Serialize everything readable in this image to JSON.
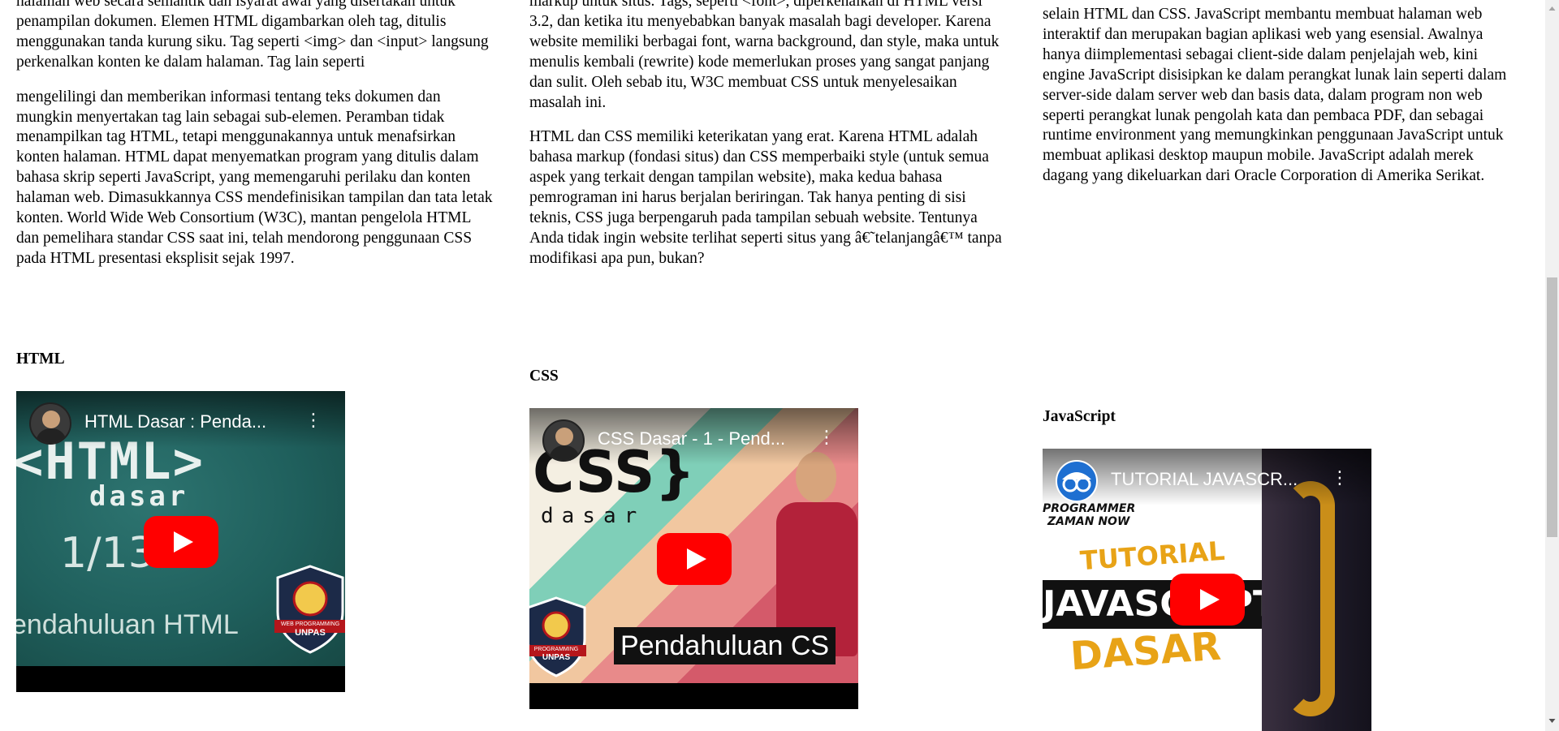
{
  "columns": [
    {
      "id": "html",
      "para1": "halaman web secara semantik dan isyarat awal yang disertakan untuk penampilan dokumen. Elemen HTML digambarkan oleh tag, ditulis menggunakan tanda kurung siku. Tag seperti <img> dan <input> langsung perkenalkan konten ke dalam halaman. Tag lain seperti",
      "para2": "mengelilingi dan memberikan informasi tentang teks dokumen dan mungkin menyertakan tag lain sebagai sub-elemen. Peramban tidak menampilkan tag HTML, tetapi menggunakannya untuk menafsirkan konten halaman. HTML dapat menyematkan program yang ditulis dalam bahasa skrip seperti JavaScript, yang memengaruhi perilaku dan konten halaman web. Dimasukkannya CSS mendefinisikan tampilan dan tata letak konten. World Wide Web Consortium (W3C), mantan pengelola HTML dan pemelihara standar CSS saat ini, telah mendorong penggunaan CSS pada HTML presentasi eksplisit sejak 1997.",
      "heading": "HTML",
      "video": {
        "title": "HTML Dasar : Penda...",
        "thumb_big": "<HTML>",
        "thumb_sub": "dasar",
        "thumb_num": "1/13",
        "thumb_caption": "endahuluan HTML",
        "badge_text": "WEB PROGRAMMING",
        "badge_name": "UNPAS"
      }
    },
    {
      "id": "css",
      "para1": "markup untuk situs. Tags, seperti <font>, diperkenalkan di HTML versi 3.2, dan ketika itu menyebabkan banyak masalah bagi developer. Karena website memiliki berbagai font, warna background, dan style, maka untuk menulis kembali (rewrite) kode memerlukan proses yang sangat panjang dan sulit. Oleh sebab itu, W3C membuat CSS untuk menyelesaikan masalah ini.",
      "para2": "HTML dan CSS memiliki keterikatan yang erat. Karena HTML adalah bahasa markup (fondasi situs) dan CSS memperbaiki style (untuk semua aspek yang terkait dengan tampilan website), maka kedua bahasa pemrograman ini harus berjalan beriringan. Tak hanya penting di sisi teknis, CSS juga berpengaruh pada tampilan sebuah website. Tentunya Anda tidak ingin website terlihat seperti situs yang â€˜telanjangâ€™ tanpa modifikasi apa pun, bukan?",
      "heading": "CSS",
      "video": {
        "title": "CSS Dasar - 1 - Pend...",
        "thumb_big": "CSS}",
        "thumb_sub": "dasar",
        "thumb_caption": "Pendahuluan CS",
        "badge_text": "PROGRAMMING",
        "badge_name": "UNPAS"
      }
    },
    {
      "id": "js",
      "para1": "selain HTML dan CSS. JavaScript membantu membuat halaman web interaktif dan merupakan bagian aplikasi web yang esensial. Awalnya hanya diimplementasi sebagai client-side dalam penjelajah web, kini engine JavaScript disisipkan ke dalam perangkat lunak lain seperti dalam server-side dalam server web dan basis data, dalam program non web seperti perangkat lunak pengolah kata dan pembaca PDF, dan sebagai runtime environment yang memungkinkan penggunaan JavaScript untuk membuat aplikasi desktop maupun mobile. JavaScript adalah merek dagang yang dikeluarkan dari Oracle Corporation di Amerika Serikat.",
      "heading": "JavaScript",
      "video": {
        "title": "TUTORIAL JAVASCR...",
        "channel_line1": "PROGRAMMER",
        "channel_line2": "ZAMAN NOW",
        "thumb_word1": "TUTORIAL",
        "thumb_word2": "JAVASCRIPT",
        "thumb_word3": "DASAR"
      }
    }
  ],
  "colors": {
    "yt_red": "#ff0000",
    "html_thumb_bg": "#1f5f5c",
    "js_accent": "#e8a317"
  },
  "icons": [
    "youtube-play-icon",
    "more-vert-icon",
    "scroll-up-arrow-icon",
    "scroll-down-arrow-icon"
  ]
}
